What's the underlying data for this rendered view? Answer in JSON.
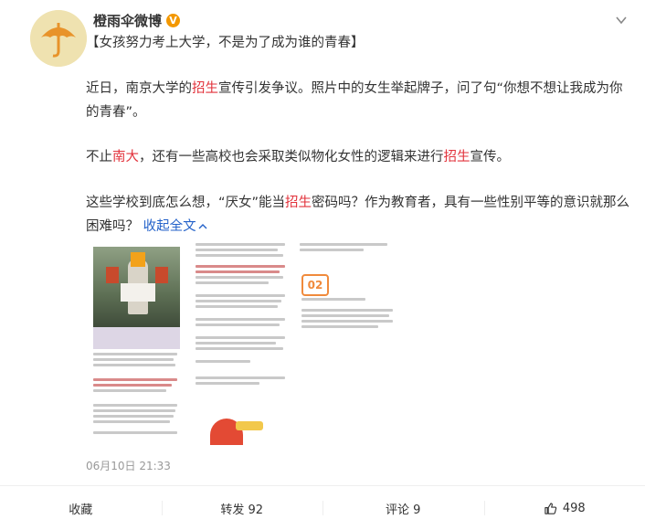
{
  "post": {
    "author": "橙雨伞微博",
    "verified_badge": "V",
    "title": "【女孩努力考上大学，不是为了成为谁的青春】",
    "p1": {
      "a": "近日，南京大学的",
      "hl": "招生",
      "b": "宣传引发争议。照片中的女生举起牌子，问了句“你想不想让我成为你的青春”。"
    },
    "p2": {
      "a": "不止",
      "hl1": "南大",
      "b": "，还有一些高校也会采取类似物化女性的逻辑来进行",
      "hl2": "招生",
      "c": "宣传。"
    },
    "p3": {
      "a": "这些学校到底怎么想，“厌女”能当",
      "hl": "招生",
      "b": "密码吗？作为教育者，具有一些性别平等的意识就那么困难吗？",
      "collapse": "收起全文"
    },
    "date": "06月10日 21:33",
    "images": {
      "badge_02": "02"
    }
  },
  "actions": {
    "collect": "收藏",
    "repost": "转发 92",
    "comment": "评论 9",
    "like": "498"
  },
  "colors": {
    "highlight": "#e2323b",
    "link": "#2462c9",
    "badge": "#f39800"
  },
  "icons": [
    "umbrella-avatar-icon",
    "chevron-down-icon",
    "like-thumb-icon"
  ]
}
